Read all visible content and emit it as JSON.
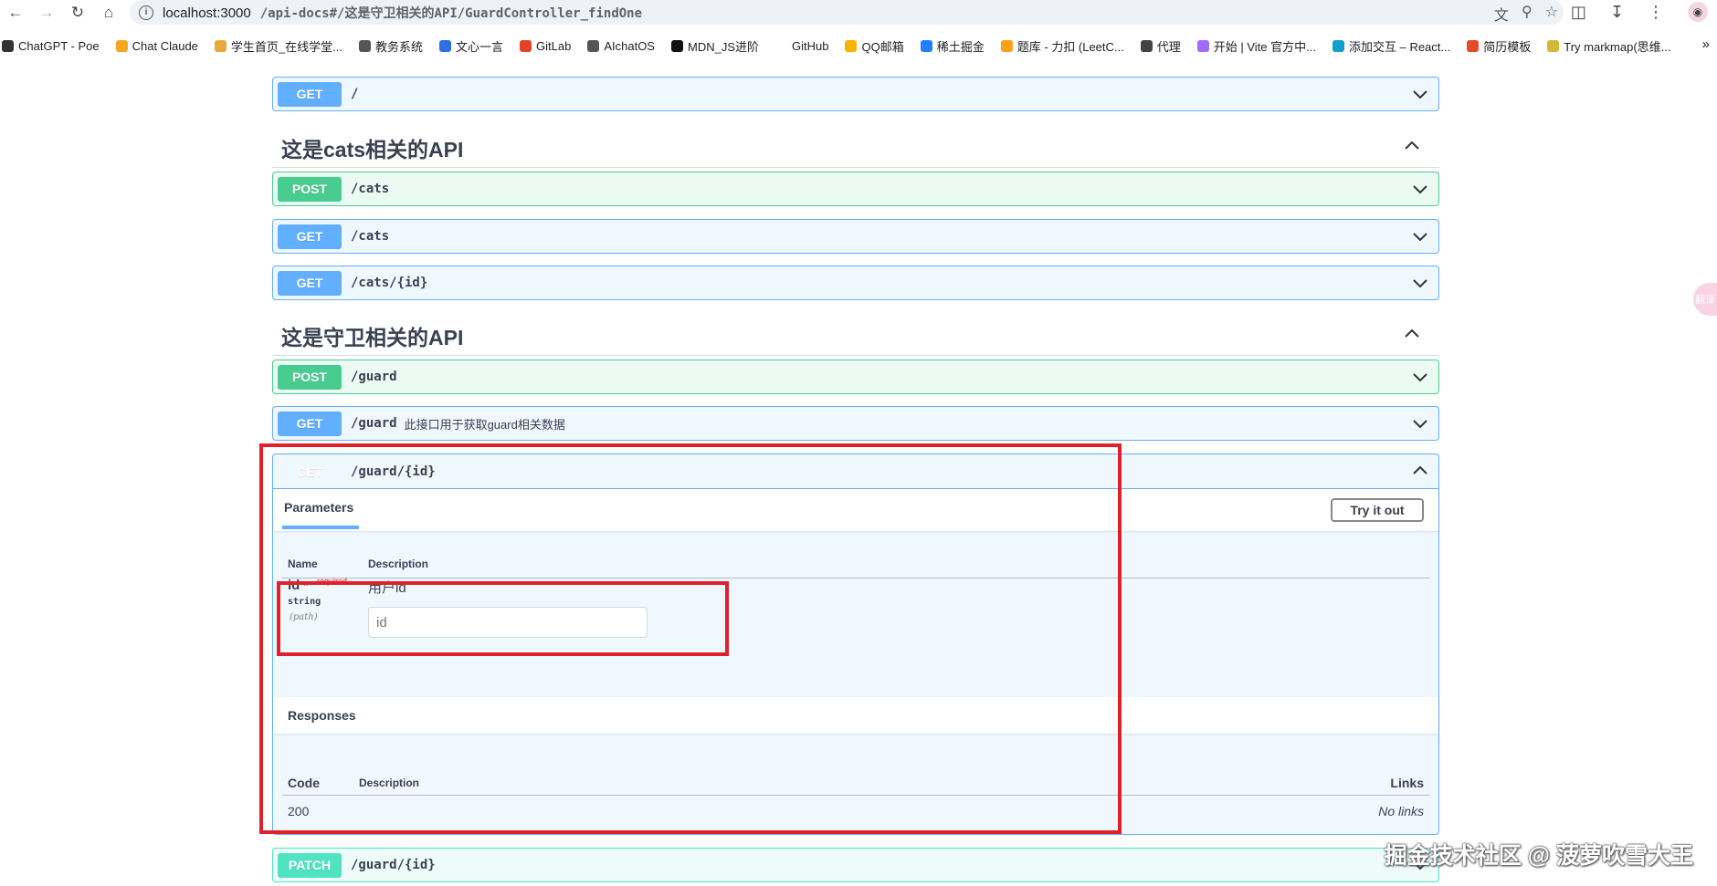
{
  "browser": {
    "url_host": "localhost:3000",
    "url_path": "/api-docs#/这是守卫相关的API/GuardController_findOne",
    "bookmarks": [
      {
        "label": "ChatGPT - Poe",
        "color": "#333333"
      },
      {
        "label": "Chat Claude",
        "color": "#f5a623"
      },
      {
        "label": "学生首页_在线学堂...",
        "color": "#e8a93b"
      },
      {
        "label": "教务系统",
        "color": "#555555"
      },
      {
        "label": "文心一言",
        "color": "#2f6fe0"
      },
      {
        "label": "GitLab",
        "color": "#e24329"
      },
      {
        "label": "AIchatOS",
        "color": "#555555"
      },
      {
        "label": "MDN_JS进阶",
        "color": "#111111"
      },
      {
        "label": "GitHub",
        "color": "#ffffff"
      },
      {
        "label": "QQ邮箱",
        "color": "#f4b400"
      },
      {
        "label": "稀土掘金",
        "color": "#1e80ff"
      },
      {
        "label": "题库 - 力扣 (LeetC...",
        "color": "#ffa116"
      },
      {
        "label": "代理",
        "color": "#444444"
      },
      {
        "label": "开始 | Vite 官方中...",
        "color": "#9f6bff"
      },
      {
        "label": "添加交互 – React...",
        "color": "#149eca"
      },
      {
        "label": "简历模板",
        "color": "#e34c26"
      },
      {
        "label": "Try markmap(思维...",
        "color": "#d4b83a"
      }
    ]
  },
  "ops_top": [
    {
      "method": "GET",
      "path": "/",
      "summary": ""
    }
  ],
  "tags": [
    {
      "title": "这是cats相关的API"
    },
    {
      "title": "这是守卫相关的API"
    }
  ],
  "cats_ops": [
    {
      "method": "POST",
      "path": "/cats"
    },
    {
      "method": "GET",
      "path": "/cats"
    },
    {
      "method": "GET",
      "path": "/cats/{id}"
    }
  ],
  "guard_ops": [
    {
      "method": "POST",
      "path": "/guard",
      "summary": ""
    },
    {
      "method": "GET",
      "path": "/guard",
      "summary": "此接口用于获取guard相关数据"
    }
  ],
  "expanded": {
    "method": "GET",
    "path": "/guard/{id}",
    "parameters_tab": "Parameters",
    "try_button": "Try it out",
    "col_name": "Name",
    "col_description": "Description",
    "param": {
      "name": "id",
      "star": "*",
      "required": "required",
      "type": "string",
      "in": "(path)",
      "description": "用户id",
      "placeholder": "id"
    },
    "responses_title": "Responses",
    "resp_col_code": "Code",
    "resp_col_description": "Description",
    "resp_col_links": "Links",
    "resp_code": "200",
    "resp_links": "No links"
  },
  "bottom_op": {
    "method": "PATCH",
    "path": "/guard/{id}"
  },
  "side_widget": "翻译",
  "watermark": "掘金技术社区 @ 菠萝吹雪大王",
  "colors": {
    "get": "#61affe",
    "post": "#49cc90",
    "patch": "#50e3c2",
    "highlight": "#e0202a"
  }
}
